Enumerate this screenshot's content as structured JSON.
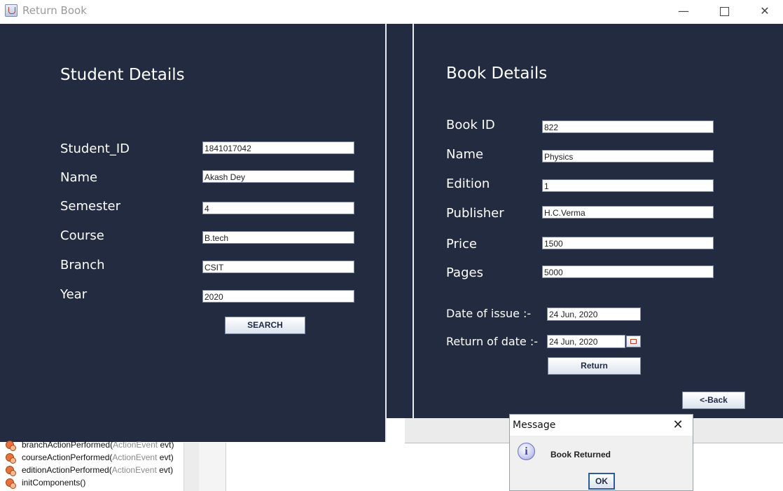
{
  "window": {
    "title": "Return Book",
    "minimize_glyph": "—",
    "close_glyph": "✕"
  },
  "student": {
    "heading": "Student Details",
    "fields": [
      {
        "label": "Student_ID",
        "value": "1841017042"
      },
      {
        "label": "Name",
        "value": "Akash Dey"
      },
      {
        "label": "Semester",
        "value": "4"
      },
      {
        "label": "Course",
        "value": "B.tech"
      },
      {
        "label": "Branch",
        "value": "CSIT"
      },
      {
        "label": "Year",
        "value": "2020"
      }
    ],
    "search_label": "SEARCH"
  },
  "book": {
    "heading": "Book Details",
    "fields": [
      {
        "label": "Book ID",
        "value": "822"
      },
      {
        "label": "Name",
        "value": "Physics"
      },
      {
        "label": "Edition",
        "value": "1"
      },
      {
        "label": "Publisher",
        "value": "H.C.Verma"
      },
      {
        "label": "Price",
        "value": "1500"
      },
      {
        "label": "Pages",
        "value": "5000"
      }
    ],
    "issue_label": "Date of issue :-",
    "issue_value": "24 Jun, 2020",
    "return_label": "Return of date :-",
    "return_value": "24 Jun, 2020",
    "return_button": "Return",
    "back_button": "<-Back"
  },
  "ide_tree": [
    {
      "name": "branchActionPerformed(",
      "param": "ActionEvent",
      "arg": " evt)"
    },
    {
      "name": "courseActionPerformed(",
      "param": "ActionEvent",
      "arg": " evt)"
    },
    {
      "name": "editionActionPerformed(",
      "param": "ActionEvent",
      "arg": " evt)"
    },
    {
      "name": "initComponents()",
      "param": "",
      "arg": ""
    }
  ],
  "dialog": {
    "title": "Message",
    "message": "Book Returned",
    "ok_label": "OK",
    "close_glyph": "✕",
    "icon_glyph": "i"
  },
  "colors": {
    "panel_bg": "#232b41",
    "heading_text": "#ffffff"
  }
}
